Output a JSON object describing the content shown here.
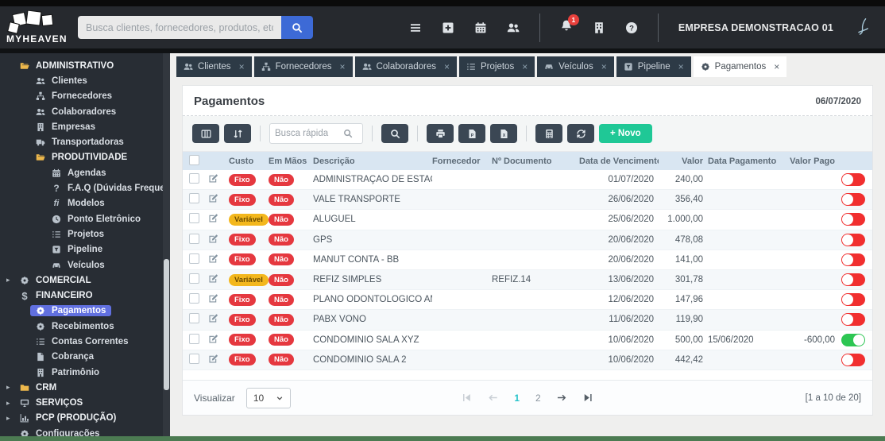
{
  "topbar": {
    "search_placeholder": "Busca clientes, fornecedores, produtos, etc...",
    "company_name": "EMPRESA DEMONSTRACAO 01",
    "notification_badge": "1"
  },
  "sidebar": {
    "items": [
      {
        "label": "ADMINISTRATIVO",
        "icon": "folder-open",
        "level": 0,
        "group": true
      },
      {
        "label": "Clientes",
        "icon": "users",
        "level": 1
      },
      {
        "label": "Fornecedores",
        "icon": "sitemap",
        "level": 1
      },
      {
        "label": "Colaboradores",
        "icon": "users",
        "level": 1
      },
      {
        "label": "Empresas",
        "icon": "building",
        "level": 1
      },
      {
        "label": "Transportadoras",
        "icon": "truck",
        "level": 1
      },
      {
        "label": "PRODUTIVIDADE",
        "icon": "folder-open",
        "level": 1,
        "group": true
      },
      {
        "label": "Agendas",
        "icon": "calendar",
        "level": 2
      },
      {
        "label": "F.A.Q (Dúvidas Frequentes)",
        "icon": "question",
        "level": 2
      },
      {
        "label": "Modelos",
        "icon": "templates",
        "level": 2
      },
      {
        "label": "Ponto Eletrônico",
        "icon": "clock",
        "level": 2
      },
      {
        "label": "Projetos",
        "icon": "tasks",
        "level": 2
      },
      {
        "label": "Pipeline",
        "icon": "pipeline",
        "level": 2
      },
      {
        "label": "Veículos",
        "icon": "car",
        "level": 2
      },
      {
        "label": "COMERCIAL",
        "icon": "gear",
        "level": 0,
        "group": true,
        "collapsed": true
      },
      {
        "label": "FINANCEIRO",
        "icon": "dollar",
        "level": 0,
        "group": true
      },
      {
        "label": "Pagamentos",
        "icon": "gear",
        "level": 1,
        "active": true
      },
      {
        "label": "Recebimentos",
        "icon": "gear",
        "level": 1
      },
      {
        "label": "Contas Correntes",
        "icon": "tasks",
        "level": 1
      },
      {
        "label": "Cobrança",
        "icon": "file",
        "level": 1
      },
      {
        "label": "Patrimônio",
        "icon": "building",
        "level": 1
      },
      {
        "label": "CRM",
        "icon": "folder",
        "level": 0,
        "group": true,
        "collapsed": true
      },
      {
        "label": "SERVIÇOS",
        "icon": "desktop",
        "level": 0,
        "group": true,
        "collapsed": true
      },
      {
        "label": "PCP (PRODUÇÃO)",
        "icon": "chart",
        "level": 0,
        "group": true,
        "collapsed": true
      },
      {
        "label": "Configurações",
        "icon": "gear",
        "level": 0
      }
    ]
  },
  "tabs": [
    {
      "label": "Clientes",
      "icon": "users"
    },
    {
      "label": "Fornecedores",
      "icon": "sitemap"
    },
    {
      "label": "Colaboradores",
      "icon": "users"
    },
    {
      "label": "Projetos",
      "icon": "tasks"
    },
    {
      "label": "Veículos",
      "icon": "car"
    },
    {
      "label": "Pipeline",
      "icon": "pipeline"
    },
    {
      "label": "Pagamentos",
      "icon": "gear",
      "active": true
    }
  ],
  "page": {
    "title": "Pagamentos",
    "date": "06/07/2020"
  },
  "toolbar": {
    "quick_search_placeholder": "Busca rápida",
    "new_button_label": "+ Novo"
  },
  "table": {
    "columns": [
      "Custo",
      "Em Mãos",
      "Descrição",
      "Fornecedor",
      "Nº Documento",
      "Data de Vencimento",
      "Valor",
      "Data Pagamento",
      "Valor Pago"
    ],
    "rows": [
      {
        "custo": "Fixo",
        "em_maos": "Não",
        "descricao": "ADMINISTRAÇÃO DE ESTAGIÁRIOS",
        "fornecedor": "",
        "n_documento": "",
        "data_vencimento": "01/07/2020",
        "valor": "240,00",
        "data_pagamento": "",
        "valor_pago": "",
        "pago": false
      },
      {
        "custo": "Fixo",
        "em_maos": "Não",
        "descricao": "VALE TRANSPORTE",
        "fornecedor": "",
        "n_documento": "",
        "data_vencimento": "26/06/2020",
        "valor": "356,40",
        "data_pagamento": "",
        "valor_pago": "",
        "pago": false
      },
      {
        "custo": "Variável",
        "em_maos": "Não",
        "descricao": "ALUGUEL",
        "fornecedor": "",
        "n_documento": "",
        "data_vencimento": "25/06/2020",
        "valor": "1.000,00",
        "data_pagamento": "",
        "valor_pago": "",
        "pago": false
      },
      {
        "custo": "Fixo",
        "em_maos": "Não",
        "descricao": "GPS",
        "fornecedor": "",
        "n_documento": "",
        "data_vencimento": "20/06/2020",
        "valor": "478,08",
        "data_pagamento": "",
        "valor_pago": "",
        "pago": false
      },
      {
        "custo": "Fixo",
        "em_maos": "Não",
        "descricao": "MANUT CONTA - BB",
        "fornecedor": "",
        "n_documento": "",
        "data_vencimento": "20/06/2020",
        "valor": "141,00",
        "data_pagamento": "",
        "valor_pago": "",
        "pago": false
      },
      {
        "custo": "Variável",
        "em_maos": "Não",
        "descricao": "REFIZ SIMPLES",
        "fornecedor": "",
        "n_documento": "REFIZ.14",
        "data_vencimento": "13/06/2020",
        "valor": "301,78",
        "data_pagamento": "",
        "valor_pago": "",
        "pago": false
      },
      {
        "custo": "Fixo",
        "em_maos": "Não",
        "descricao": "PLANO ODONTOLOGICO AMIL",
        "fornecedor": "",
        "n_documento": "",
        "data_vencimento": "12/06/2020",
        "valor": "147,96",
        "data_pagamento": "",
        "valor_pago": "",
        "pago": false
      },
      {
        "custo": "Fixo",
        "em_maos": "Não",
        "descricao": "PABX VONO",
        "fornecedor": "",
        "n_documento": "",
        "data_vencimento": "11/06/2020",
        "valor": "119,90",
        "data_pagamento": "",
        "valor_pago": "",
        "pago": false
      },
      {
        "custo": "Fixo",
        "em_maos": "Não",
        "descricao": "CONDOMINIO SALA XYZ",
        "fornecedor": "",
        "n_documento": "",
        "data_vencimento": "10/06/2020",
        "valor": "500,00",
        "data_pagamento": "15/06/2020",
        "valor_pago": "-600,00",
        "pago": true
      },
      {
        "custo": "Fixo",
        "em_maos": "Não",
        "descricao": "CONDOMINIO SALA 2",
        "fornecedor": "",
        "n_documento": "",
        "data_vencimento": "10/06/2020",
        "valor": "442,42",
        "data_pagamento": "",
        "valor_pago": "",
        "pago": false
      }
    ]
  },
  "footer": {
    "visualizar_label": "Visualizar",
    "page_size": "10",
    "pages": [
      "1",
      "2"
    ],
    "active_page": "1",
    "range_label": "[1 a 10 de 20]"
  },
  "colors": {
    "accent_green": "#1fc896",
    "badge_red": "#e5383f",
    "badge_yellow": "#f3b71d",
    "toggle_on": "#2dc653",
    "toggle_off": "#f12f2f",
    "active_sidebar_item": "#6170e0",
    "active_page": "#25c2ca"
  }
}
